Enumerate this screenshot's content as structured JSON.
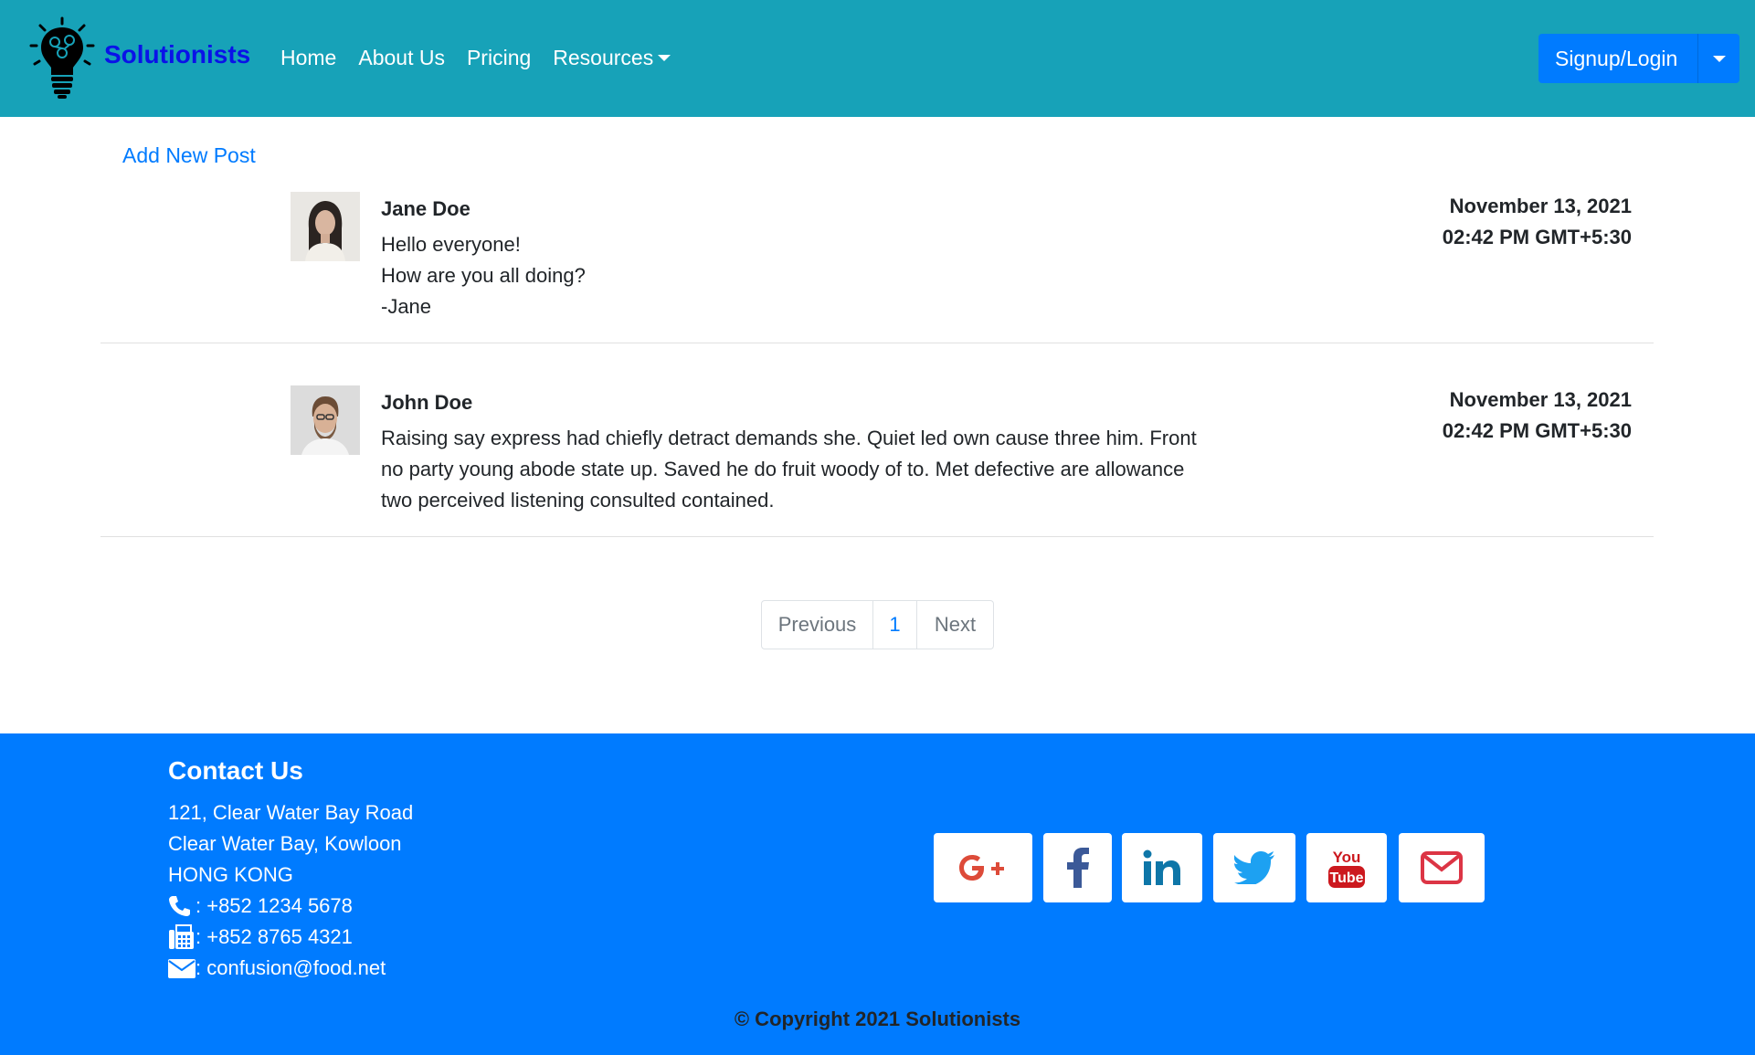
{
  "navbar": {
    "brand": "Solutionists",
    "links": [
      "Home",
      "About Us",
      "Pricing",
      "Resources"
    ],
    "signup_label": "Signup/Login"
  },
  "main": {
    "add_post_label": "Add New Post",
    "posts": [
      {
        "author": "Jane Doe",
        "lines": [
          "Hello everyone!",
          "How are you all doing?",
          "-Jane"
        ],
        "date": "November 13, 2021",
        "time": "02:42 PM GMT+5:30"
      },
      {
        "author": "John Doe",
        "lines": [
          "Raising say express had chiefly detract demands she. Quiet led own cause three him. Front",
          "no party young abode state up. Saved he do fruit woody of to. Met defective are allowance",
          "two perceived listening consulted contained."
        ],
        "date": "November 13, 2021",
        "time": "02:42 PM GMT+5:30"
      }
    ],
    "pagination": {
      "prev": "Previous",
      "page": "1",
      "next": "Next"
    }
  },
  "footer": {
    "title": "Contact Us",
    "address": [
      "121, Clear Water Bay Road",
      "Clear Water Bay, Kowloon",
      "HONG KONG"
    ],
    "phone": ": +852 1234 5678",
    "fax": ": +852 8765 4321",
    "email": ": confusion@food.net",
    "social_icons": [
      "google-plus-icon",
      "facebook-icon",
      "linkedin-icon",
      "twitter-icon",
      "youtube-icon",
      "mail-icon"
    ],
    "copyright": "© Copyright 2021 Solutionists"
  },
  "colors": {
    "navbar": "#17a2b8",
    "brand": "#0a12e8",
    "primary": "#007bff",
    "google": "#dd4b39",
    "facebook": "#3b5998",
    "linkedin": "#0e76a8",
    "twitter": "#1da1f2",
    "youtube": "#cc181e"
  }
}
